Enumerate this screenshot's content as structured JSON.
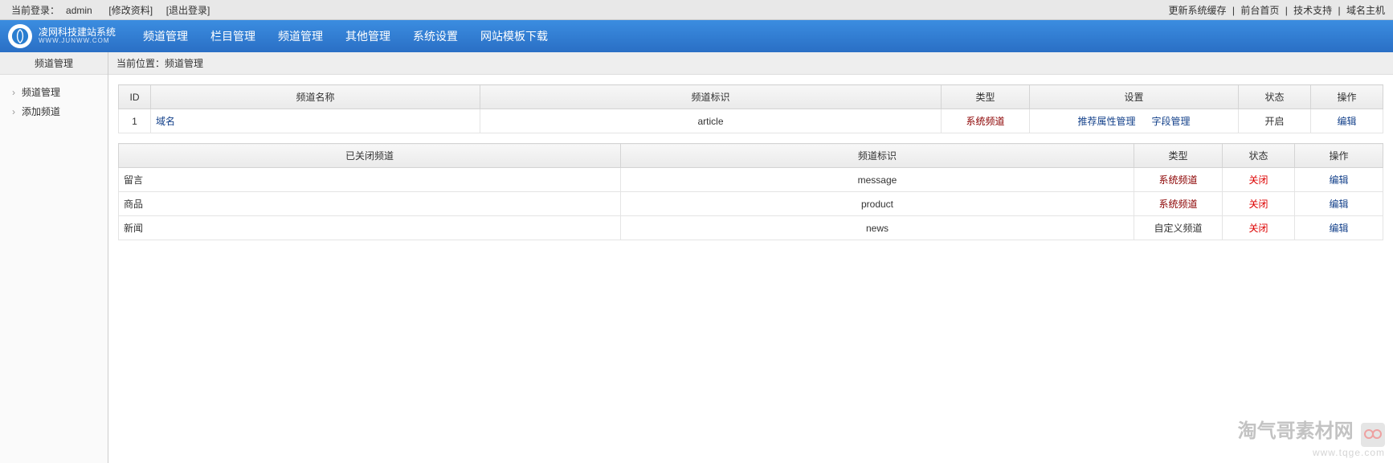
{
  "topbar": {
    "login_label": "当前登录：",
    "username": "admin",
    "edit_profile": "[修改资料]",
    "logout": "[退出登录]",
    "refresh_cache": "更新系统缓存",
    "frontend": "前台首页",
    "support": "技术支持",
    "domain_host": "域名主机"
  },
  "brand": {
    "title": "凌网科技建站系统",
    "sub": "WWW.JUNWW.COM"
  },
  "nav": [
    "频道管理",
    "栏目管理",
    "频道管理",
    "其他管理",
    "系统设置",
    "网站模板下载"
  ],
  "sidebar": {
    "header": "频道管理",
    "items": [
      "频道管理",
      "添加频道"
    ]
  },
  "crumb": {
    "label": "当前位置：",
    "value": "频道管理"
  },
  "table1": {
    "headers": [
      "ID",
      "频道名称",
      "频道标识",
      "类型",
      "设置",
      "状态",
      "操作"
    ],
    "rows": [
      {
        "id": "1",
        "name": "域名",
        "slug": "article",
        "type": "系统频道",
        "set1": "推荐属性管理",
        "set2": "字段管理",
        "status": "开启",
        "op": "编辑"
      }
    ]
  },
  "table2": {
    "headers": [
      "已关闭频道",
      "频道标识",
      "类型",
      "状态",
      "操作"
    ],
    "rows": [
      {
        "name": "留言",
        "slug": "message",
        "type": "系统频道",
        "status": "关闭",
        "op": "编辑"
      },
      {
        "name": "商品",
        "slug": "product",
        "type": "系统频道",
        "status": "关闭",
        "op": "编辑"
      },
      {
        "name": "新闻",
        "slug": "news",
        "type": "自定义频道",
        "status": "关闭",
        "op": "编辑"
      }
    ]
  },
  "watermark": {
    "line1": "淘气哥素材网",
    "line2": "www.tqge.com"
  }
}
